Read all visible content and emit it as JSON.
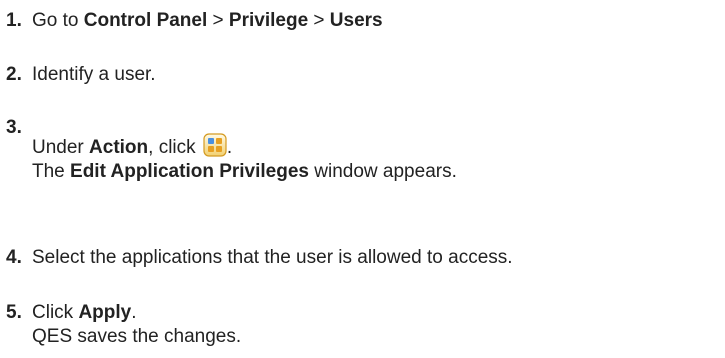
{
  "steps": [
    {
      "number": "1.",
      "parts": [
        {
          "text": "Go to "
        },
        {
          "text": "Control Panel",
          "bold": true
        },
        {
          "text": " > "
        },
        {
          "text": "Privilege",
          "bold": true
        },
        {
          "text": " > "
        },
        {
          "text": "Users",
          "bold": true
        }
      ]
    },
    {
      "number": "2.",
      "parts": [
        {
          "text": "Identify a user."
        }
      ]
    },
    {
      "number": "3.",
      "line1": {
        "prefix": "Under ",
        "bold": "Action",
        "suffix": ", click ",
        "end": ".",
        "icon": "application-privileges-icon"
      },
      "line2": {
        "prefix": "The ",
        "bold": "Edit Application Privileges",
        "suffix": " window appears."
      }
    },
    {
      "number": "4.",
      "parts": [
        {
          "text": "Select the applications that the user is allowed to access."
        }
      ]
    },
    {
      "number": "5.",
      "line1": {
        "prefix": "Click ",
        "bold": "Apply",
        "suffix": "."
      },
      "line2": {
        "text": "QES saves the changes."
      }
    }
  ]
}
